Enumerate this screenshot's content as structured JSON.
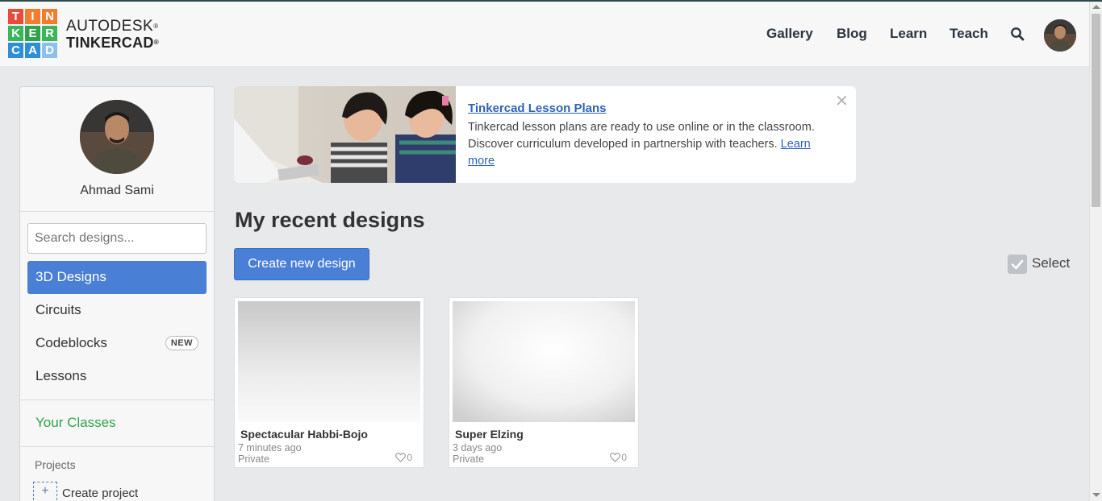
{
  "header": {
    "logo_letters": [
      "T",
      "I",
      "N",
      "K",
      "E",
      "R",
      "C",
      "A",
      "D"
    ],
    "logo_colors": [
      "#e84a3b",
      "#f27d2e",
      "#f27d2e",
      "#3bb55a",
      "#2fa34b",
      "#3bb55a",
      "#2f8fd6",
      "#2f8fd6",
      "#8fc0ea"
    ],
    "brand_line1": "AUTODESK",
    "brand_line2": "TINKERCAD",
    "nav": [
      {
        "label": "Gallery"
      },
      {
        "label": "Blog"
      },
      {
        "label": "Learn"
      },
      {
        "label": "Teach"
      }
    ],
    "search_icon": "search-icon",
    "avatar_icon": "user-avatar"
  },
  "sidebar": {
    "username": "Ahmad Sami",
    "search_placeholder": "Search designs...",
    "items": [
      {
        "label": "3D Designs",
        "active": true
      },
      {
        "label": "Circuits"
      },
      {
        "label": "Codeblocks",
        "badge": "NEW"
      },
      {
        "label": "Lessons"
      }
    ],
    "your_classes": "Your Classes",
    "projects_label": "Projects",
    "create_project_icon": "+",
    "create_project_label": "Create project",
    "accent_color": "#4a7fd6",
    "classes_color": "#2fa34b"
  },
  "banner": {
    "title": "Tinkercad Lesson Plans",
    "text": "Tinkercad lesson plans are ready to use online or in the classroom. Discover curriculum developed in partnership with teachers.",
    "link": "Learn more",
    "close_icon": "close-icon"
  },
  "main": {
    "section_title": "My recent designs",
    "create_button": "Create new design",
    "select_label": "Select",
    "designs": [
      {
        "title": "Spectacular Habbi-Bojo",
        "time": "7 minutes ago",
        "privacy": "Private",
        "likes": "0"
      },
      {
        "title": "Super Elzing",
        "time": "3 days ago",
        "privacy": "Private",
        "likes": "0"
      }
    ]
  }
}
